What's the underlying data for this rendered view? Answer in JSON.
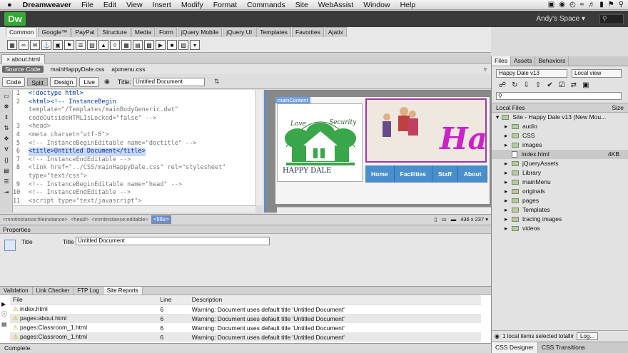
{
  "menubar": {
    "apple": "",
    "app_name": "Dreamweaver",
    "items": [
      "File",
      "Edit",
      "View",
      "Insert",
      "Modify",
      "Format",
      "Commands",
      "Site",
      "WebAssist",
      "Window",
      "Help"
    ],
    "right_icons": [
      "screen-icon",
      "evernote-icon",
      "time-machine-icon",
      "wifi-icon",
      "volume-icon",
      "battery-icon",
      "flag-icon",
      "spotlight-icon"
    ]
  },
  "appbar": {
    "logo": "Dw",
    "workspace": "Andy's Space ▾"
  },
  "insert": {
    "tabs": [
      "Common",
      "Google™",
      "PayPal",
      "Structure",
      "Media",
      "Form",
      "jQuery Mobile",
      "jQuery UI",
      "Templates",
      "Favorites",
      "Ajatix"
    ],
    "active_tab": "Common"
  },
  "document": {
    "tab": "about.html",
    "related": [
      "Source Code",
      "mainHappyDale.css",
      "ajxmenu.css"
    ],
    "view_buttons": [
      "Code",
      "Split",
      "Design",
      "Live"
    ],
    "title_label": "Title:",
    "title_value": "Untitled Document"
  },
  "code_lines": [
    {
      "n": "1",
      "t": "<!doctype html>",
      "c": "tg"
    },
    {
      "n": "2",
      "t": "<html><!-- InstanceBegin",
      "c": "tg"
    },
    {
      "n": "",
      "t": "template=\"/Templates/mainBodyGeneric.dwt\"",
      "c": "cm"
    },
    {
      "n": "",
      "t": "codeOutsideHTMLIsLocked=\"false\" -->",
      "c": "cm"
    },
    {
      "n": "3",
      "t": "<head>",
      "c": "cm"
    },
    {
      "n": "4",
      "t": "<meta charset=\"utf-8\">",
      "c": "cm"
    },
    {
      "n": "5",
      "t": "<!-- InstanceBeginEditable name=\"doctitle\" -->",
      "c": "cm"
    },
    {
      "n": "6",
      "t": "<title>Untitled Document</title>",
      "c": "hl"
    },
    {
      "n": "7",
      "t": "<!-- InstanceEndEditable -->",
      "c": "cm"
    },
    {
      "n": "8",
      "t": "<link href=\"../CSS/mainHappyDale.css\" rel=\"stylesheet\"",
      "c": "cm"
    },
    {
      "n": "",
      "t": "type=\"text/css\">",
      "c": "cm"
    },
    {
      "n": "9",
      "t": "<!-- InstanceBeginEditable name=\"head\" -->",
      "c": "cm"
    },
    {
      "n": "10",
      "t": "<!-- InstanceEndEditable -->",
      "c": "cm"
    },
    {
      "n": "11",
      "t": "<script type=\"text/javascript\">",
      "c": "cm"
    }
  ],
  "design": {
    "container_label": "mainContent",
    "logo_text": "HAPPY DALE",
    "logo_arc_left": "Love",
    "logo_arc_right": "Security",
    "banner_text": "Ha",
    "nav": [
      "Home",
      "Facilities",
      "Staff",
      "About"
    ]
  },
  "statusbar": {
    "tags": [
      "<mmtinstance:fileinstance>",
      "<head>",
      "<mmtinstance:editable>",
      "<title>"
    ],
    "selected_tag": "<title>",
    "size": "436 x 237 ▾"
  },
  "properties": {
    "header": "Properties",
    "element_label": "Title",
    "field_label": "Title",
    "field_value": "Untitled Document"
  },
  "results": {
    "tabs": [
      "Validation",
      "Link Checker",
      "FTP Log",
      "Site Reports"
    ],
    "active_tab": "Site Reports",
    "columns": [
      "File",
      "Line",
      "Description"
    ],
    "rows": [
      {
        "file": "index.html",
        "line": "6",
        "desc": "Warning: Document uses default title 'Untitled Document'"
      },
      {
        "file": "pages:about.html",
        "line": "6",
        "desc": "Warning: Document uses default title 'Untitled Document'"
      },
      {
        "file": "pages:Classroom_1.html",
        "line": "6",
        "desc": "Warning: Document uses default title 'Untitled Document'"
      },
      {
        "file": "pages:Classroom_1.html",
        "line": "6",
        "desc": "Warning: Document uses default title 'Untitled Document'"
      }
    ]
  },
  "bottom_status": "Complete.",
  "files_panel": {
    "tabs": [
      "Files",
      "Assets",
      "Behaviors"
    ],
    "active_tab": "Files",
    "site_select": "Happy Dale v13",
    "view_select": "Local view",
    "col_local": "Local Files",
    "col_size": "Size",
    "root": "Site - Happy Dale v13 (New Mou...",
    "items": [
      {
        "name": "audio",
        "type": "folder",
        "size": ""
      },
      {
        "name": "CSS",
        "type": "folder",
        "size": ""
      },
      {
        "name": "images",
        "type": "folder",
        "size": ""
      },
      {
        "name": "index.html",
        "type": "file",
        "size": "4KB"
      },
      {
        "name": "jQueryAssets",
        "type": "folder",
        "size": ""
      },
      {
        "name": "Library",
        "type": "folder",
        "size": ""
      },
      {
        "name": "mainMenu",
        "type": "folder",
        "size": ""
      },
      {
        "name": "originals",
        "type": "folder",
        "size": ""
      },
      {
        "name": "pages",
        "type": "folder",
        "size": ""
      },
      {
        "name": "Templates",
        "type": "folder",
        "size": ""
      },
      {
        "name": "tracing images",
        "type": "folder",
        "size": ""
      },
      {
        "name": "videos",
        "type": "folder",
        "size": ""
      }
    ],
    "status": "1 local items selected totallir",
    "log_button": "Log...",
    "bottom_tabs": [
      "CSS Designer",
      "CSS Transitions"
    ]
  }
}
